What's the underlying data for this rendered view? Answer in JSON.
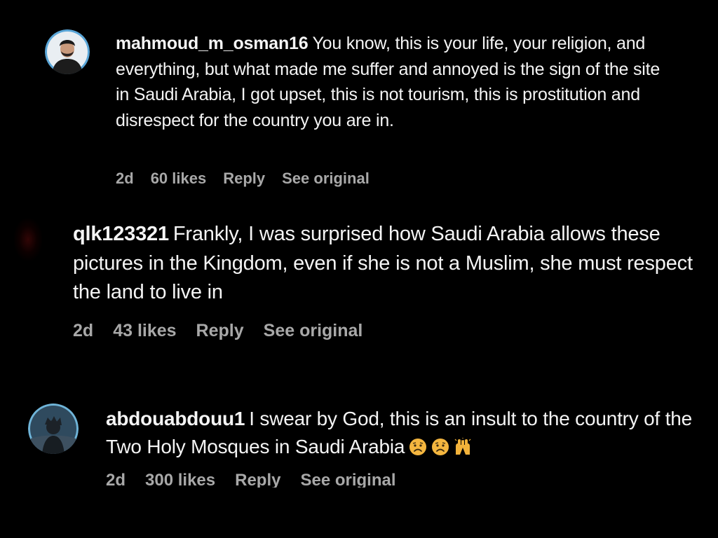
{
  "comments": [
    {
      "username": "mahmoud_m_osman16",
      "text": "You know, this is your life, your religion, and everything, but what made me suffer and annoyed is the sign of the site in Saudi Arabia, I got upset, this is not tourism, this is prostitution and disrespect for the country you are in.",
      "time": "2d",
      "likes": "60 likes",
      "reply": "Reply",
      "see_original": "See original",
      "avatar_icon": "profile-photo-man-icon"
    },
    {
      "username": "qlk123321",
      "text": "Frankly, I was surprised how Saudi Arabia allows these pictures in the Kingdom, even if she is not a Muslim, she must respect the land to live in",
      "time": "2d",
      "likes": "43 likes",
      "reply": "Reply",
      "see_original": "See original"
    },
    {
      "username": "abdouabdouu1",
      "text": "I swear by God, this is an insult to the country of the Two Holy Mosques in Saudi Arabia",
      "emojis": [
        "frowning-face-icon",
        "frowning-face-icon",
        "raised-hands-icon"
      ],
      "time": "2d",
      "likes": "300 likes",
      "reply": "Reply",
      "see_original": "See original",
      "avatar_icon": "profile-photo-silhouette-icon"
    }
  ],
  "colors": {
    "background": "#000000",
    "text": "#f4f4f4",
    "meta": "#a8a8a8"
  }
}
